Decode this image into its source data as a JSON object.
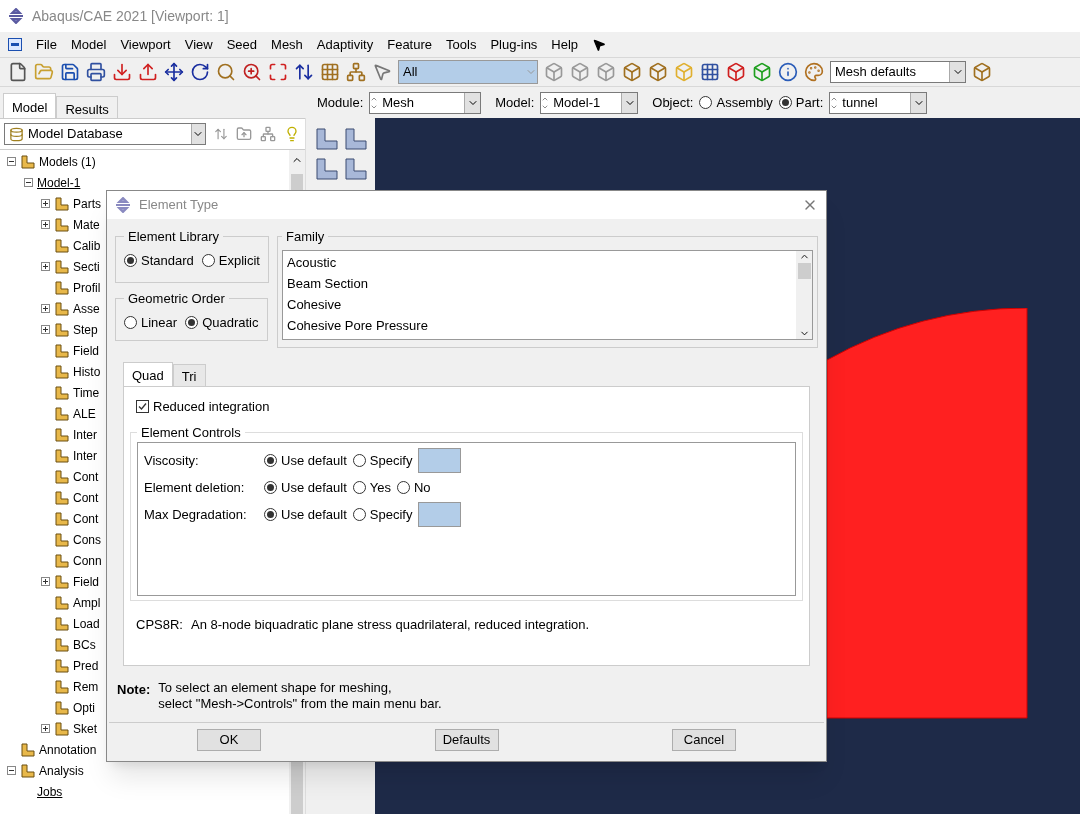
{
  "window": {
    "title": "Abaqus/CAE 2021 [Viewport: 1]"
  },
  "menu": [
    "File",
    "Model",
    "Viewport",
    "View",
    "Seed",
    "Mesh",
    "Adaptivity",
    "Feature",
    "Tools",
    "Plug-ins",
    "Help"
  ],
  "toolbar": {
    "selection_filter": "All",
    "render_style": "Mesh defaults"
  },
  "context_bar": {
    "module_label": "Module:",
    "module": "Mesh",
    "model_label": "Model:",
    "model": "Model-1",
    "object_label": "Object:",
    "objects": [
      {
        "label": "Assembly",
        "selected": false
      },
      {
        "label": "Part:",
        "selected": true
      }
    ],
    "part": "tunnel"
  },
  "left_tabs": [
    {
      "label": "Model",
      "selected": true
    },
    {
      "label": "Results",
      "selected": false
    }
  ],
  "database": "Model Database",
  "tree": [
    {
      "label": "Models (1)",
      "expanded": true,
      "children": [
        {
          "label": "Model-1",
          "expanded": true,
          "children": [
            {
              "label": "Parts",
              "expandable": true
            },
            {
              "label": "Mate",
              "expandable": true
            },
            {
              "label": "Calib",
              "expandable": false
            },
            {
              "label": "Secti",
              "expandable": true
            },
            {
              "label": "Profil",
              "expandable": false
            },
            {
              "label": "Asse",
              "expandable": true
            },
            {
              "label": "Step",
              "expandable": true
            },
            {
              "label": "Field",
              "expandable": false
            },
            {
              "label": "Histo",
              "expandable": false
            },
            {
              "label": "Time",
              "expandable": false
            },
            {
              "label": "ALE",
              "expandable": false
            },
            {
              "label": "Inter",
              "expandable": false
            },
            {
              "label": "Inter",
              "expandable": false
            },
            {
              "label": "Cont",
              "expandable": false
            },
            {
              "label": "Cont",
              "expandable": false
            },
            {
              "label": "Cont",
              "expandable": false
            },
            {
              "label": "Cons",
              "expandable": false
            },
            {
              "label": "Conn",
              "expandable": false
            },
            {
              "label": "Field",
              "expandable": true
            },
            {
              "label": "Ampl",
              "expandable": false
            },
            {
              "label": "Load",
              "expandable": false
            },
            {
              "label": "BCs",
              "expandable": false
            },
            {
              "label": "Pred",
              "expandable": false
            },
            {
              "label": "Rem",
              "expandable": false
            },
            {
              "label": "Opti",
              "expandable": false
            },
            {
              "label": "Sket",
              "expandable": true
            }
          ]
        }
      ]
    },
    {
      "label": "Annotation",
      "expandable": false
    },
    {
      "label": "Analysis",
      "expanded": true,
      "children": [
        {
          "label": "Jobs",
          "expandable": false
        }
      ]
    }
  ],
  "dialog": {
    "title": "Element Type",
    "element_library": {
      "label": "Element Library",
      "options": [
        {
          "label": "Standard",
          "selected": true
        },
        {
          "label": "Explicit",
          "selected": false
        }
      ]
    },
    "geometric_order": {
      "label": "Geometric Order",
      "options": [
        {
          "label": "Linear",
          "selected": false
        },
        {
          "label": "Quadratic",
          "selected": true
        }
      ]
    },
    "family": {
      "label": "Family",
      "items": [
        "Acoustic",
        "Beam Section",
        "Cohesive",
        "Cohesive Pore Pressure"
      ]
    },
    "tabs": [
      {
        "label": "Quad",
        "selected": true
      },
      {
        "label": "Tri",
        "selected": false
      }
    ],
    "reduced_integration": {
      "label": "Reduced integration",
      "checked": true
    },
    "element_controls": {
      "label": "Element Controls",
      "rows": [
        {
          "label": "Viscosity:",
          "kind": "radio_field",
          "options": [
            {
              "label": "Use default",
              "selected": true
            },
            {
              "label": "Specify",
              "selected": false
            }
          ]
        },
        {
          "label": "Element deletion:",
          "kind": "radio",
          "options": [
            {
              "label": "Use default",
              "selected": true
            },
            {
              "label": "Yes",
              "selected": false
            },
            {
              "label": "No",
              "selected": false
            }
          ]
        },
        {
          "label": "Max Degradation:",
          "kind": "radio_field",
          "options": [
            {
              "label": "Use default",
              "selected": true
            },
            {
              "label": "Specify",
              "selected": false
            }
          ]
        }
      ]
    },
    "description": {
      "code": "CPS8R:",
      "text": "An 8-node biquadratic plane stress quadrilateral, reduced integration."
    },
    "note": {
      "label": "Note:",
      "lines": [
        "To select an element shape for meshing,",
        "select \"Mesh->Controls\" from the main menu bar."
      ]
    },
    "buttons": [
      "OK",
      "Defaults",
      "Cancel"
    ]
  }
}
